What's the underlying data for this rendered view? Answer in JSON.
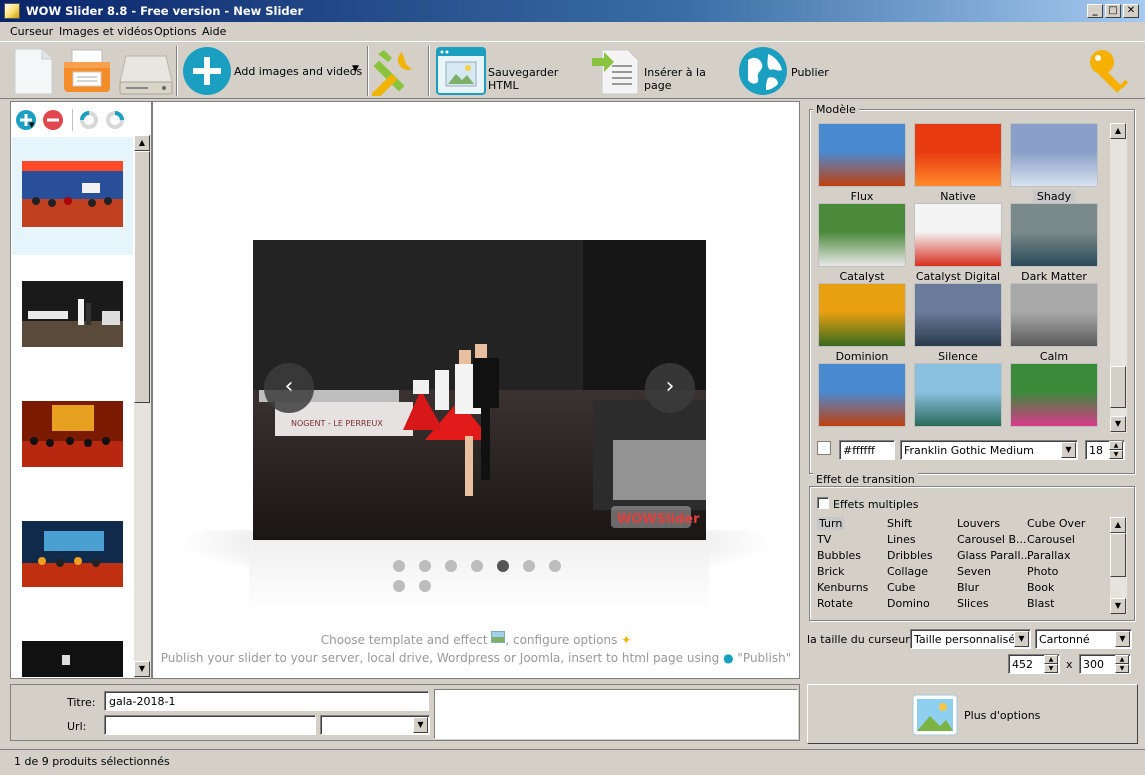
{
  "window": {
    "title": "WOW Slider 8.8 - Free version - New Slider"
  },
  "menu": [
    "Curseur",
    "Images et vidéos",
    "Options",
    "Aide"
  ],
  "toolbar": {
    "add_images_label": "Add images and videos",
    "save_html_label": "Sauvegarder HTML",
    "insert_label": "Insérer à la page",
    "publish_label": "Publier"
  },
  "slides_list": {
    "count": 9,
    "selected_index": 0
  },
  "preview": {
    "watermark": "WOWSlider",
    "banner_text": "NOGENT - LE PERREUX",
    "bullets_row1": 7,
    "bullets_row2": 2,
    "active_bullet": 5,
    "hint_line1_a": "Choose template and effect",
    "hint_line1_b": ", configure options",
    "hint_line2_a": "Publish your slider to your server, local drive, Wordpress or Joomla, insert to html page using",
    "hint_line2_b": "\"Publish\""
  },
  "slide_props": {
    "title_label": "Titre:",
    "title_value": "gala-2018-1",
    "url_label": "Url:",
    "url_value": ""
  },
  "template_group": {
    "title": "Modèle",
    "templates": [
      "Flux",
      "Native",
      "Shady",
      "Catalyst",
      "Catalyst Digital",
      "Dark Matter",
      "Dominion",
      "Silence",
      "Calm",
      "",
      "",
      ""
    ],
    "selected": "Shady",
    "color_value": "#ffffff",
    "font_value": "Franklin Gothic Medium",
    "font_size": "18"
  },
  "effect_group": {
    "title": "Effet de transition",
    "multiple_label": "Effets multiples",
    "columns": [
      [
        "Turn",
        "TV",
        "Bubbles",
        "Brick",
        "Kenburns",
        "Rotate"
      ],
      [
        "Shift",
        "Lines",
        "Dribbles",
        "Collage",
        "Cube",
        "Domino"
      ],
      [
        "Louvers",
        "Carousel B...",
        "Glass Parall...",
        "Seven",
        "Blur",
        "Slices"
      ],
      [
        "Cube Over",
        "Carousel",
        "Parallax",
        "Photo",
        "Book",
        "Blast"
      ]
    ],
    "selected": "Turn"
  },
  "size": {
    "label": "la taille du curseur",
    "size_mode": "Taille personnalisée",
    "skin": "Cartonné",
    "width": "452",
    "x_sep": "x",
    "height": "300"
  },
  "more_options_label": "Plus d'options",
  "status": "1 de 9 produits sélectionnés",
  "colors": {
    "accent_teal": "#1a9fc0",
    "remove_red": "#e0474c",
    "selection_blue": "#e6f4fb"
  }
}
